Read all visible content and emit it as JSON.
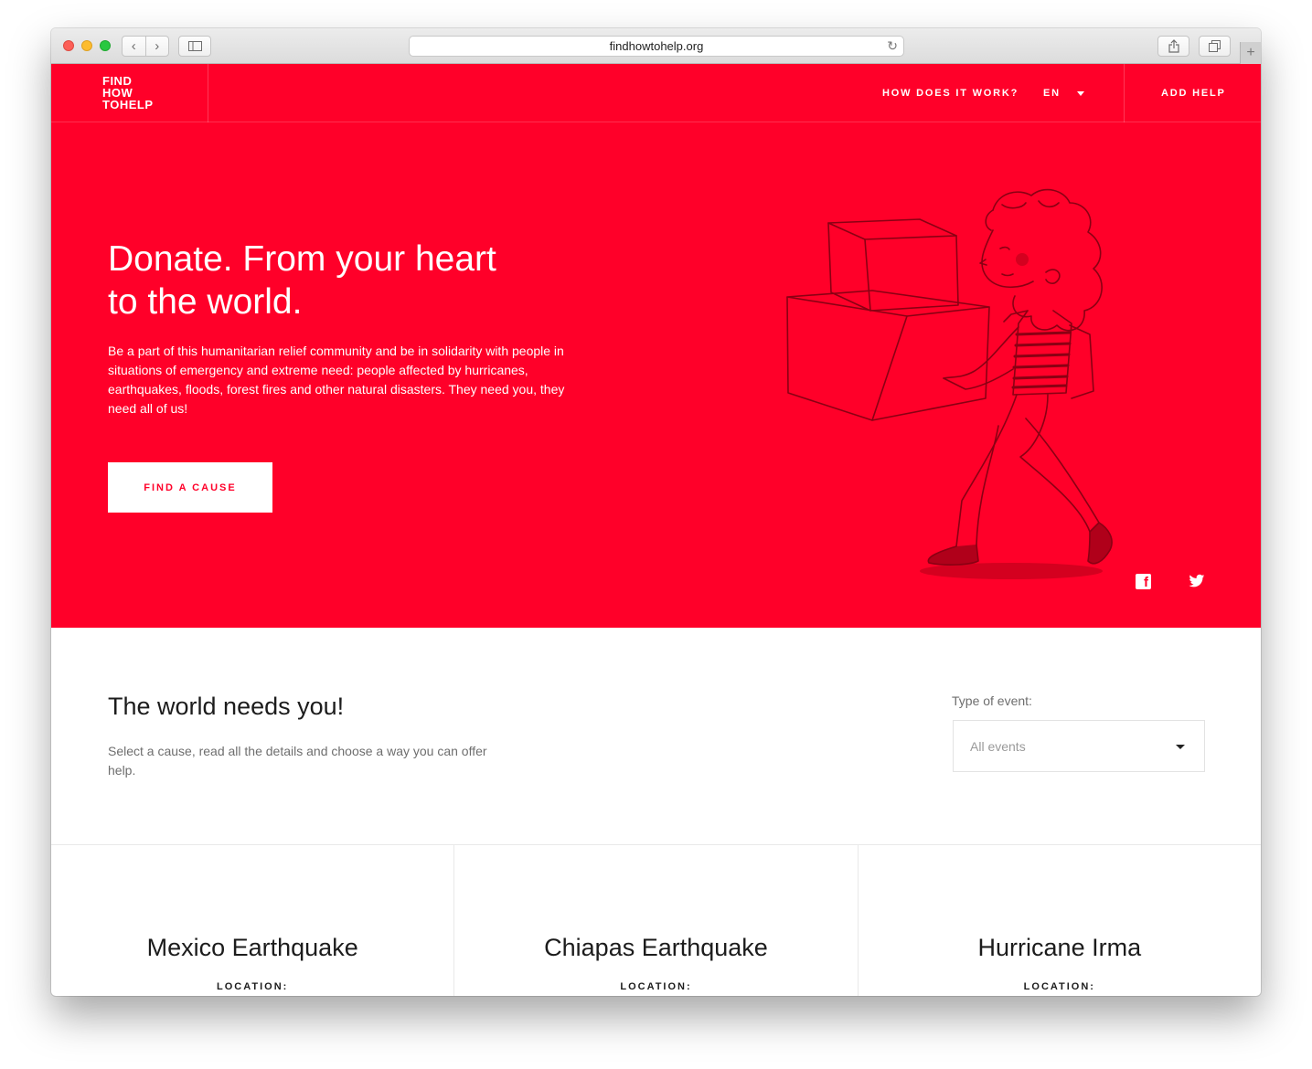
{
  "browser": {
    "url": "findhowtohelp.org"
  },
  "nav": {
    "logo_lines": [
      "FIND",
      "HOW",
      "TOHELP"
    ],
    "how_it_works": "HOW DOES IT WORK?",
    "language": "EN",
    "add_help": "ADD HELP"
  },
  "hero": {
    "title_line1": "Donate. From your heart",
    "title_line2": "to the world.",
    "description": "Be a part of this humanitarian relief community and be in solidarity with people in situations of emergency and extreme need: people affected by hurricanes, earthquakes, floods, forest fires and other natural disasters. They need you, they need all of us!",
    "cta_label": "FIND A CAUSE",
    "social": [
      "facebook-icon",
      "twitter-icon"
    ]
  },
  "causes_section": {
    "title": "The world needs you!",
    "description": "Select a cause, read all the details and choose a way you can offer help.",
    "filter_label": "Type of event:",
    "filter_value": "All events"
  },
  "cards": [
    {
      "title": "Mexico Earthquake",
      "location_label": "LOCATION:"
    },
    {
      "title": "Chiapas Earthquake",
      "location_label": "LOCATION:"
    },
    {
      "title": "Hurricane Irma",
      "location_label": "LOCATION:"
    }
  ],
  "colors": {
    "brand_red": "#ff0029",
    "line_art": "#8a0013"
  }
}
